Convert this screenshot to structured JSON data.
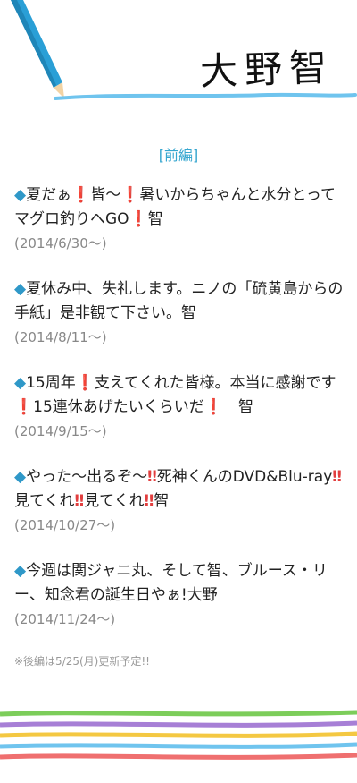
{
  "header": {
    "title": "大野智"
  },
  "section_label": "[前編]",
  "entries": [
    {
      "text_parts": [
        "◆",
        "夏だぁ",
        "❗",
        "皆〜",
        "❗",
        "暑いからちゃんと水分とってマグロ釣りへGO",
        "❗",
        "智"
      ],
      "date": "(2014/6/30〜)"
    },
    {
      "text_parts": [
        "◆",
        "夏休み中、失礼します。ニノの「硫黄島からの手紙」是非観て下さい。智"
      ],
      "date": "(2014/8/11〜)"
    },
    {
      "text_parts": [
        "◆",
        "15周年",
        "❗",
        "支えてくれた皆様。本当に感謝です",
        "❗",
        "15連休あげたいくらいだ",
        "❗",
        "　智"
      ],
      "date": "(2014/9/15〜)"
    },
    {
      "text_parts": [
        "◆",
        "やった〜出るぞ〜",
        "‼",
        "死神くんのDVD&Blu-ray",
        "‼",
        "見てくれ",
        "‼",
        "見てくれ",
        "‼",
        "智"
      ],
      "date": "(2014/10/27〜)"
    },
    {
      "text_parts": [
        "◆",
        "今週は関ジャニ丸、そして智、ブルース・リー、知念君の誕生日やぁ!大野"
      ],
      "date": "(2014/11/24〜)"
    }
  ],
  "note": "※後編は5/25(月)更新予定!!",
  "colors": {
    "accent": "#35a6cf",
    "pencil": "#2a9fd6",
    "stripes": [
      "#7ccd5a",
      "#a77fd6",
      "#f4c842",
      "#6fc4ee",
      "#ef6f6f"
    ]
  }
}
